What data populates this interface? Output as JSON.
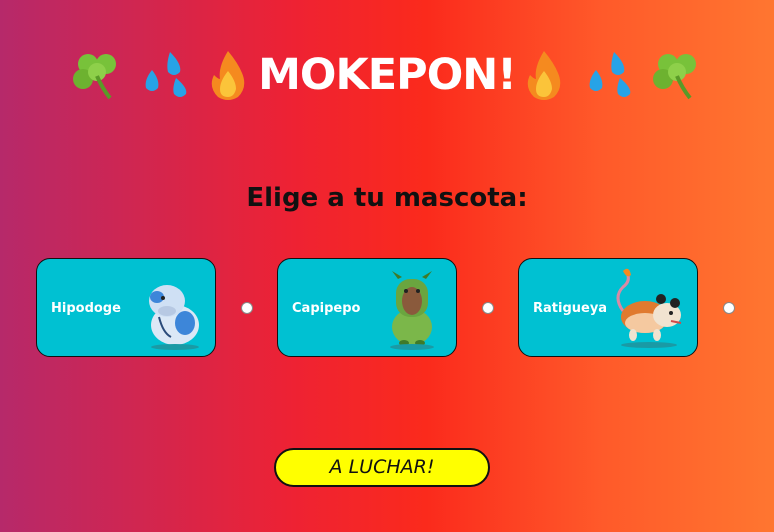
{
  "header": {
    "title": "MOKEPON!",
    "decorations": [
      "shamrock-icon",
      "droplets-icon",
      "fire-icon",
      "fire-icon",
      "droplets-icon",
      "shamrock-icon"
    ]
  },
  "selection": {
    "prompt": "Elige a tu mascota:"
  },
  "pets": [
    {
      "name": "Hipodoge",
      "icon": "hipodoge-icon",
      "selected": false
    },
    {
      "name": "Capipepo",
      "icon": "capipepo-icon",
      "selected": false
    },
    {
      "name": "Ratigueya",
      "icon": "ratigueya-icon",
      "selected": false
    }
  ],
  "actions": {
    "fight_label": "A LUCHAR!"
  },
  "colors": {
    "background_start": "#b6296a",
    "background_end": "#ff7630",
    "card": "#00c1d2",
    "button": "#ffff00"
  }
}
